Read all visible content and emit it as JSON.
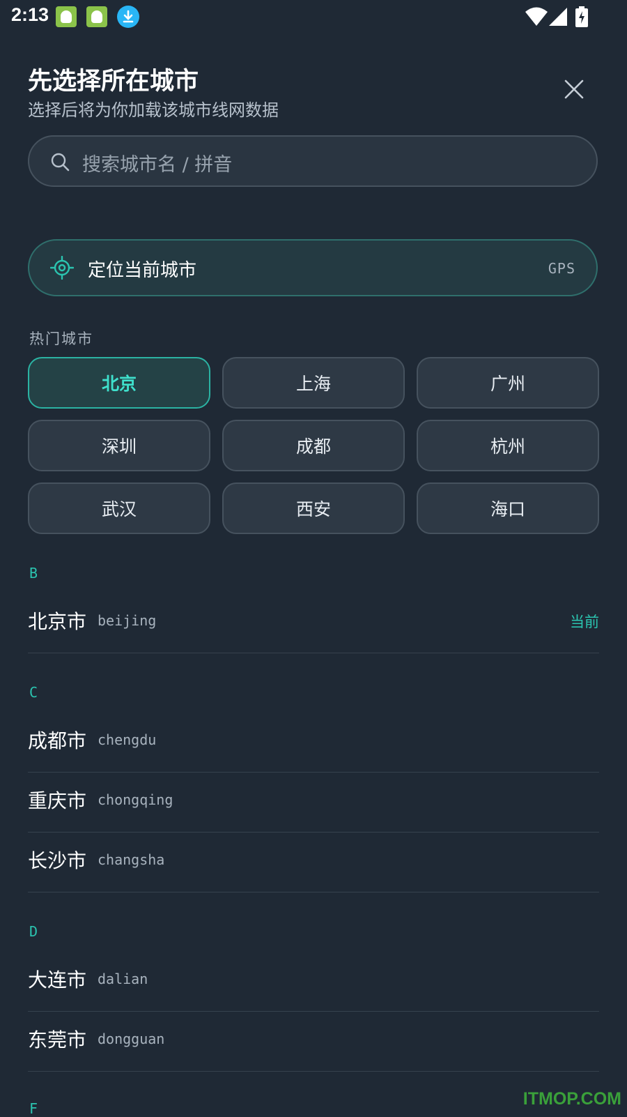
{
  "status_bar": {
    "time": "2:13",
    "icons": [
      "app-icon",
      "app-icon",
      "download-icon",
      "wifi-icon",
      "signal-icon",
      "battery-charging-icon"
    ]
  },
  "header": {
    "title": "先选择所在城市",
    "subtitle": "选择后将为你加载该城市线网数据",
    "close_icon": "close-icon"
  },
  "search": {
    "placeholder": "搜索城市名 / 拼音",
    "icon": "search-icon"
  },
  "locate": {
    "label": "定位当前城市",
    "tag": "GPS",
    "icon": "crosshair-icon"
  },
  "hot_cities": {
    "label": "热门城市",
    "items": [
      {
        "label": "北京",
        "selected": true
      },
      {
        "label": "上海",
        "selected": false
      },
      {
        "label": "广州",
        "selected": false
      },
      {
        "label": "深圳",
        "selected": false
      },
      {
        "label": "成都",
        "selected": false
      },
      {
        "label": "杭州",
        "selected": false
      },
      {
        "label": "武汉",
        "selected": false
      },
      {
        "label": "西安",
        "selected": false
      },
      {
        "label": "海口",
        "selected": false
      }
    ]
  },
  "sections": [
    {
      "letter": "B",
      "cities": [
        {
          "name": "北京市",
          "pinyin": "beijing",
          "badge": "当前"
        }
      ]
    },
    {
      "letter": "C",
      "cities": [
        {
          "name": "成都市",
          "pinyin": "chengdu"
        },
        {
          "name": "重庆市",
          "pinyin": "chongqing"
        },
        {
          "name": "长沙市",
          "pinyin": "changsha"
        }
      ]
    },
    {
      "letter": "D",
      "cities": [
        {
          "name": "大连市",
          "pinyin": "dalian"
        },
        {
          "name": "东莞市",
          "pinyin": "dongguan"
        }
      ]
    },
    {
      "letter": "F",
      "cities": []
    }
  ],
  "watermark": "ITMOP.COM",
  "colors": {
    "background": "#1f2935",
    "accent": "#2bc4b0",
    "chip_selected_text": "#3fe0cc",
    "watermark": "#3aa03a"
  }
}
